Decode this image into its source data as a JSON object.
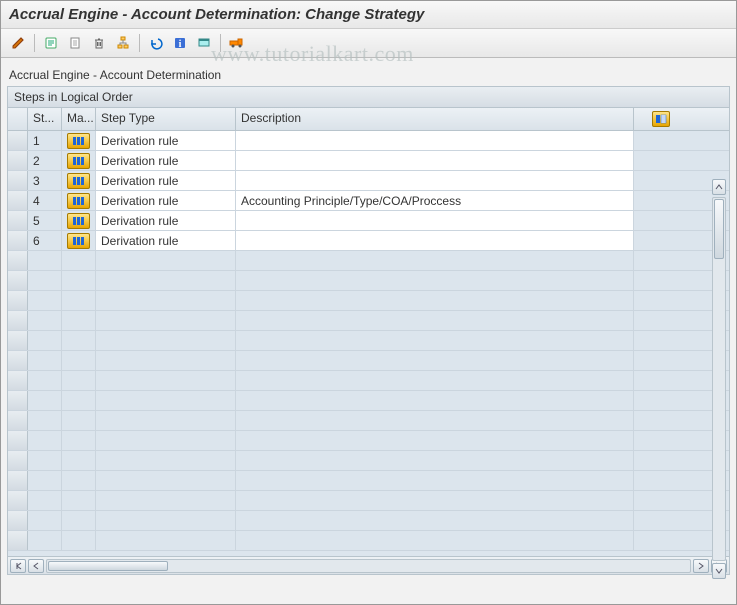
{
  "title": "Accrual Engine - Account Determination: Change Strategy",
  "watermark": "www.tutorialkart.com",
  "subheader": "Accrual Engine - Account Determination",
  "panel_title": "Steps in Logical Order",
  "columns": {
    "step": "St...",
    "ma": "Ma...",
    "type": "Step Type",
    "desc": "Description"
  },
  "rows": [
    {
      "step": "1",
      "type": "Derivation rule",
      "desc": ""
    },
    {
      "step": "2",
      "type": "Derivation rule",
      "desc": ""
    },
    {
      "step": "3",
      "type": "Derivation rule",
      "desc": ""
    },
    {
      "step": "4",
      "type": "Derivation rule",
      "desc": "Accounting Principle/Type/COA/Proccess"
    },
    {
      "step": "5",
      "type": "Derivation rule",
      "desc": ""
    },
    {
      "step": "6",
      "type": "Derivation rule",
      "desc": ""
    }
  ],
  "empty_rows": 15
}
